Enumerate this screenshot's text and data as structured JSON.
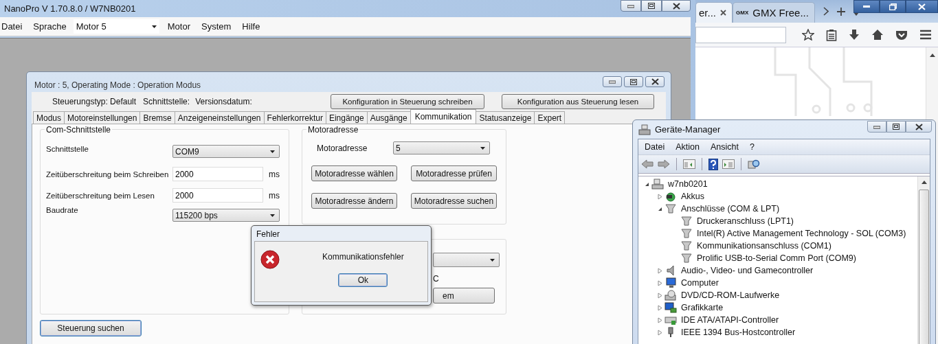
{
  "nanopro": {
    "title": "NanoPro V 1.70.8.0 / W7NB0201",
    "menu_left": [
      "Datei",
      "Sprache"
    ],
    "motor_select": "Motor 5",
    "menu_right": [
      "Motor",
      "System",
      "Hilfe"
    ]
  },
  "motor_window": {
    "title": "Motor : 5, Operating Mode : Operation Modus",
    "info": [
      "Steuerungstyp: Default",
      "Schnittstelle:",
      "Versionsdatum:"
    ],
    "config_buttons": [
      "Konfiguration in Steuerung schreiben",
      "Konfiguration aus Steuerung lesen"
    ],
    "tabs": [
      {
        "label": "Modus",
        "selected": false
      },
      {
        "label": "Motoreinstellungen",
        "selected": false
      },
      {
        "label": "Bremse",
        "selected": false
      },
      {
        "label": "Anzeigeneinstellungen",
        "selected": false
      },
      {
        "label": "Fehlerkorrektur",
        "selected": false
      },
      {
        "label": "Eingänge",
        "selected": false
      },
      {
        "label": "Ausgänge",
        "selected": false
      },
      {
        "label": "Kommunikation",
        "selected": true
      },
      {
        "label": "Statusanzeige",
        "selected": false
      },
      {
        "label": "Expert",
        "selected": false
      }
    ],
    "com_group": {
      "title": "Com-Schnittstelle",
      "fields": [
        {
          "kind": "combo",
          "label": "Schnittstelle",
          "value": "COM9"
        },
        {
          "kind": "text",
          "label": "Zeitüberschreitung beim Schreiben",
          "value": "2000",
          "unit": "ms"
        },
        {
          "kind": "text",
          "label": "Zeitüberschreitung beim Lesen",
          "value": "2000",
          "unit": "ms"
        },
        {
          "kind": "combo",
          "label": "Baudrate",
          "value": "115200 bps"
        }
      ]
    },
    "address_group": {
      "title": "Motoradresse",
      "label": "Motoradresse",
      "value": "5",
      "buttons": [
        "Motoradresse wählen",
        "Motoradresse prüfen",
        "Motoradresse ändern",
        "Motoradresse suchen"
      ]
    },
    "covered_group": {
      "label": "C",
      "button": "em"
    },
    "search_button": "Steuerung suchen"
  },
  "error_dialog": {
    "title": "Fehler",
    "message": "Kommunikationsfehler",
    "button": "Ok"
  },
  "browser": {
    "tabs": [
      {
        "label": "er...",
        "selected": true
      },
      {
        "label": "GMX Free...",
        "logo": "GMX",
        "selected": false
      }
    ]
  },
  "device_manager": {
    "title": "Geräte-Manager",
    "menu": [
      "Datei",
      "Aktion",
      "Ansicht",
      "?"
    ],
    "tree": {
      "label": "w7nb0201",
      "expanded": true,
      "children": [
        {
          "label": "Akkus",
          "expanded": false
        },
        {
          "label": "Anschlüsse (COM & LPT)",
          "expanded": true,
          "children": [
            {
              "label": "Druckeranschluss (LPT1)"
            },
            {
              "label": "Intel(R) Active Management Technology - SOL (COM3)"
            },
            {
              "label": "Kommunikationsanschluss (COM1)"
            },
            {
              "label": "Prolific USB-to-Serial Comm Port (COM9)"
            }
          ]
        },
        {
          "label": "Audio-, Video- und Gamecontroller",
          "expanded": false
        },
        {
          "label": "Computer",
          "expanded": false
        },
        {
          "label": "DVD/CD-ROM-Laufwerke",
          "expanded": false
        },
        {
          "label": "Grafikkarte",
          "expanded": false
        },
        {
          "label": "IDE ATA/ATAPI-Controller",
          "expanded": false
        },
        {
          "label": "IEEE 1394 Bus-Hostcontroller",
          "expanded": false
        }
      ]
    }
  }
}
